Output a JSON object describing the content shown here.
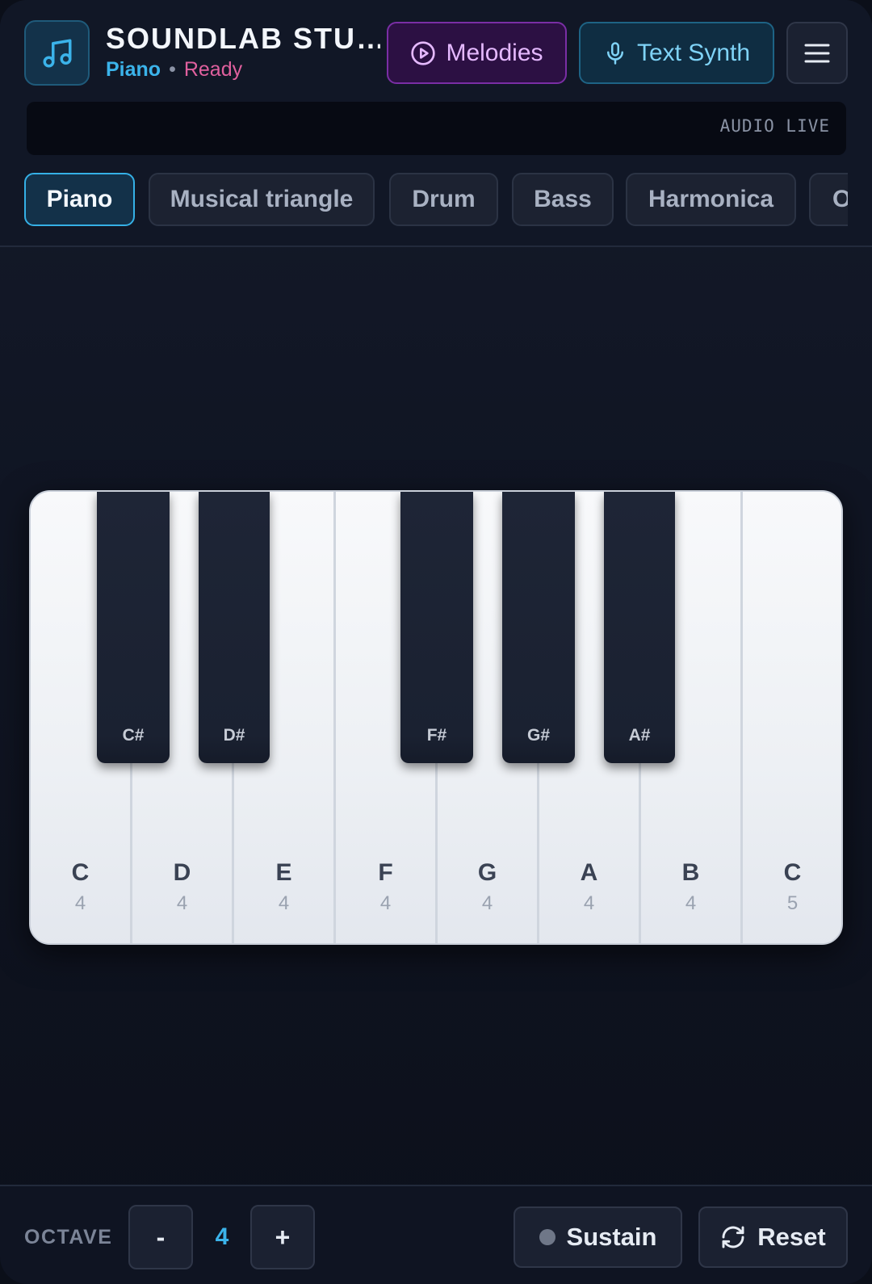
{
  "header": {
    "title": "SOUNDLAB STU…",
    "instrument": "Piano",
    "status": "Ready",
    "melodies_label": "Melodies",
    "text_synth_label": "Text Synth",
    "audio_label": "AUDIO LIVE"
  },
  "tabs": [
    {
      "label": "Piano",
      "active": true
    },
    {
      "label": "Musical triangle",
      "active": false
    },
    {
      "label": "Drum",
      "active": false
    },
    {
      "label": "Bass",
      "active": false
    },
    {
      "label": "Harmonica",
      "active": false
    },
    {
      "label": "O",
      "active": false
    }
  ],
  "keyboard": {
    "white_keys": [
      {
        "note": "C",
        "octave": "4"
      },
      {
        "note": "D",
        "octave": "4"
      },
      {
        "note": "E",
        "octave": "4"
      },
      {
        "note": "F",
        "octave": "4"
      },
      {
        "note": "G",
        "octave": "4"
      },
      {
        "note": "A",
        "octave": "4"
      },
      {
        "note": "B",
        "octave": "4"
      },
      {
        "note": "C",
        "octave": "5"
      }
    ],
    "black_keys": [
      {
        "note": "C#"
      },
      {
        "note": "D#"
      },
      {
        "note": "F#"
      },
      {
        "note": "G#"
      },
      {
        "note": "A#"
      }
    ]
  },
  "footer": {
    "octave_label": "OCTAVE",
    "octave_minus": "-",
    "octave_value": "4",
    "octave_plus": "+",
    "sustain_label": "Sustain",
    "reset_label": "Reset"
  },
  "colors": {
    "accent_blue": "#3bb3ea",
    "accent_purple": "#7a2ea5",
    "status_pink": "#e0609e"
  },
  "icons": {
    "logo": "music-note-icon",
    "melodies": "play-circle-icon",
    "text_synth": "microphone-icon",
    "menu": "hamburger-menu-icon",
    "reset": "refresh-icon"
  }
}
